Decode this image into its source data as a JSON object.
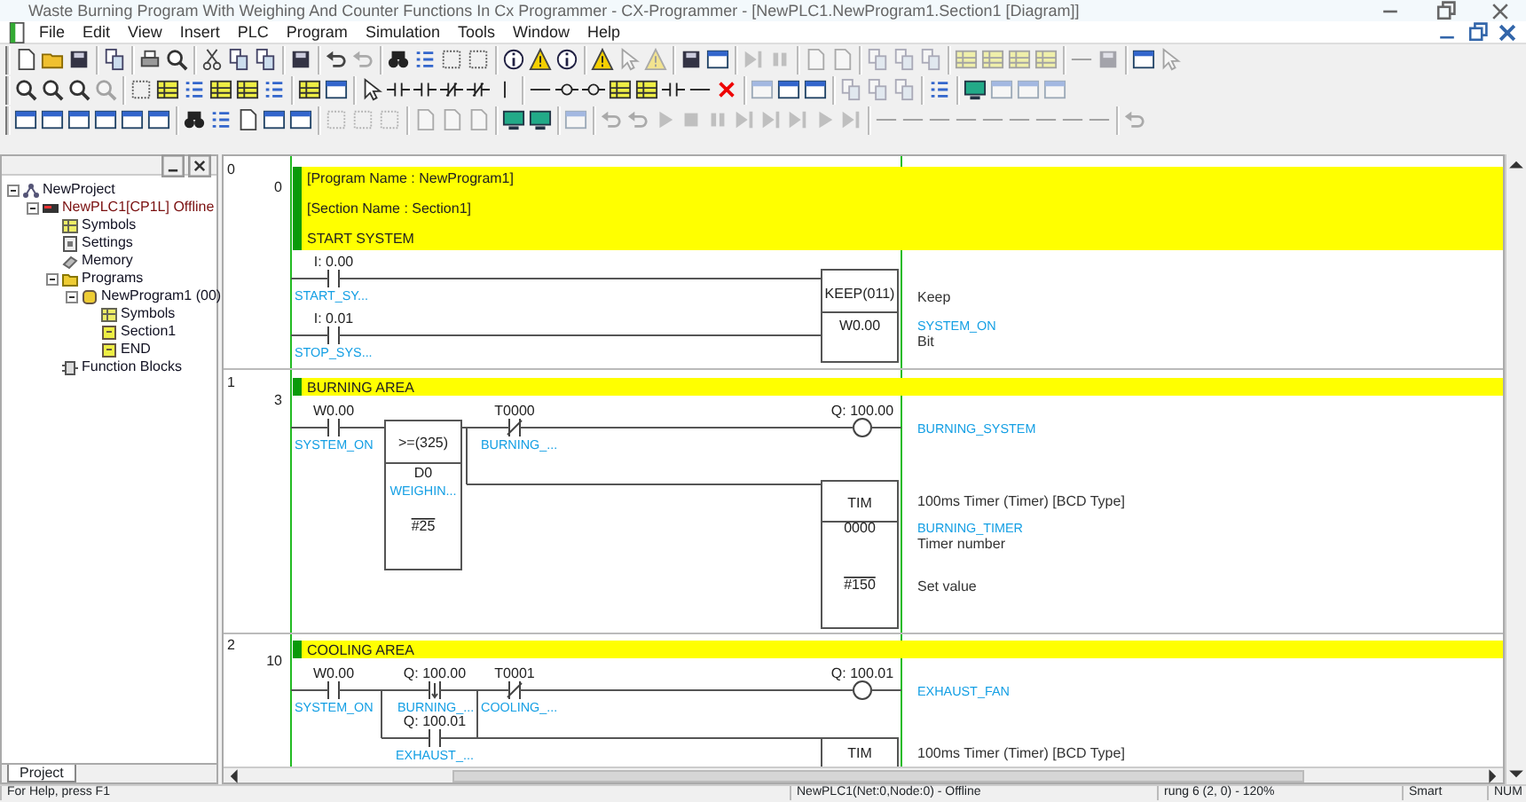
{
  "window": {
    "title": "Waste Burning Program With Weighing And Counter Functions In Cx Programmer - CX-Programmer - [NewPLC1.NewProgram1.Section1 [Diagram]]"
  },
  "menu": [
    "File",
    "Edit",
    "View",
    "Insert",
    "PLC",
    "Program",
    "Simulation",
    "Tools",
    "Window",
    "Help"
  ],
  "project_tree": [
    {
      "label": "NewProject",
      "kind": "network",
      "expanded": true,
      "children": [
        {
          "label": "NewPLC1[CP1L] Offline",
          "kind": "plc",
          "expanded": true,
          "children": [
            {
              "label": "Symbols",
              "kind": "symbols"
            },
            {
              "label": "Settings",
              "kind": "settings"
            },
            {
              "label": "Memory",
              "kind": "memory"
            },
            {
              "label": "Programs",
              "kind": "programs",
              "expanded": true,
              "children": [
                {
                  "label": "NewProgram1 (00)",
                  "kind": "program",
                  "expanded": true,
                  "children": [
                    {
                      "label": "Symbols",
                      "kind": "symbols"
                    },
                    {
                      "label": "Section1",
                      "kind": "section"
                    },
                    {
                      "label": "END",
                      "kind": "section"
                    }
                  ]
                }
              ]
            },
            {
              "label": "Function Blocks",
              "kind": "blocks"
            }
          ]
        }
      ]
    }
  ],
  "project_tab": {
    "label": "Project",
    "selected": true
  },
  "diagram": {
    "rungs": [
      {
        "rung": "0",
        "step": "0",
        "comments": [
          "[Program Name : NewProgram1]",
          "[Section Name : Section1]",
          "START SYSTEM"
        ],
        "elements": [
          {
            "kind": "contact",
            "address": "I: 0.00",
            "symbol": "START_SY..."
          },
          {
            "kind": "contact",
            "address": "I: 0.01",
            "symbol": "STOP_SYS..."
          },
          {
            "kind": "block",
            "mnemonic": "KEEP(011)",
            "operands": [
              {
                "value": "W0.00",
                "constant": false
              }
            ]
          }
        ],
        "notes": [
          {
            "text": "Keep",
            "kind": "comment"
          },
          {
            "text": "SYSTEM_ON",
            "kind": "symbol"
          },
          {
            "text": "Bit",
            "kind": "comment"
          }
        ]
      },
      {
        "rung": "1",
        "step": "3",
        "comments": [
          "BURNING AREA"
        ],
        "elements": [
          {
            "kind": "contact",
            "address": "W0.00",
            "symbol": "SYSTEM_ON"
          },
          {
            "kind": "block",
            "mnemonic": ">=(325)",
            "operands": [
              {
                "value": "D0",
                "symbol": "WEIGHIN...",
                "constant": false
              },
              {
                "value": "#25",
                "constant": true
              }
            ]
          },
          {
            "kind": "closedcontact",
            "address": "T0000",
            "symbol": "BURNING_..."
          },
          {
            "kind": "coil",
            "address": "Q: 100.00"
          },
          {
            "kind": "block",
            "mnemonic": "TIM",
            "operands": [
              {
                "value": "0000",
                "constant": false
              },
              {
                "value": "#150",
                "constant": true
              }
            ]
          }
        ],
        "notes": [
          {
            "text": "BURNING_SYSTEM",
            "kind": "symbol"
          },
          {
            "text": "100ms Timer (Timer) [BCD Type]",
            "kind": "comment"
          },
          {
            "text": "BURNING_TIMER",
            "kind": "symbol"
          },
          {
            "text": "Timer number",
            "kind": "comment"
          },
          {
            "text": "Set value",
            "kind": "comment"
          }
        ]
      },
      {
        "rung": "2",
        "step": "10",
        "comments": [
          "COOLING AREA"
        ],
        "elements": [
          {
            "kind": "contact",
            "address": "W0.00",
            "symbol": "SYSTEM_ON"
          },
          {
            "kind": "downcontact",
            "address": "Q: 100.00",
            "symbol": "BURNING_..."
          },
          {
            "kind": "closedcontact",
            "address": "T0001",
            "symbol": "COOLING_..."
          },
          {
            "kind": "coil",
            "address": "Q: 100.01"
          },
          {
            "kind": "contact",
            "address": "Q: 100.01",
            "symbol": "EXHAUST_..."
          },
          {
            "kind": "block",
            "mnemonic": "TIM"
          }
        ],
        "notes": [
          {
            "text": "EXHAUST_FAN",
            "kind": "symbol"
          },
          {
            "text": "100ms Timer (Timer) [BCD Type]",
            "kind": "comment"
          }
        ]
      }
    ]
  },
  "status_bar": [
    "For Help, press F1",
    "NewPLC1(Net:0,Node:0) - Offline",
    "rung 6 (2, 0) - 120%",
    "Smart",
    "NUM"
  ]
}
